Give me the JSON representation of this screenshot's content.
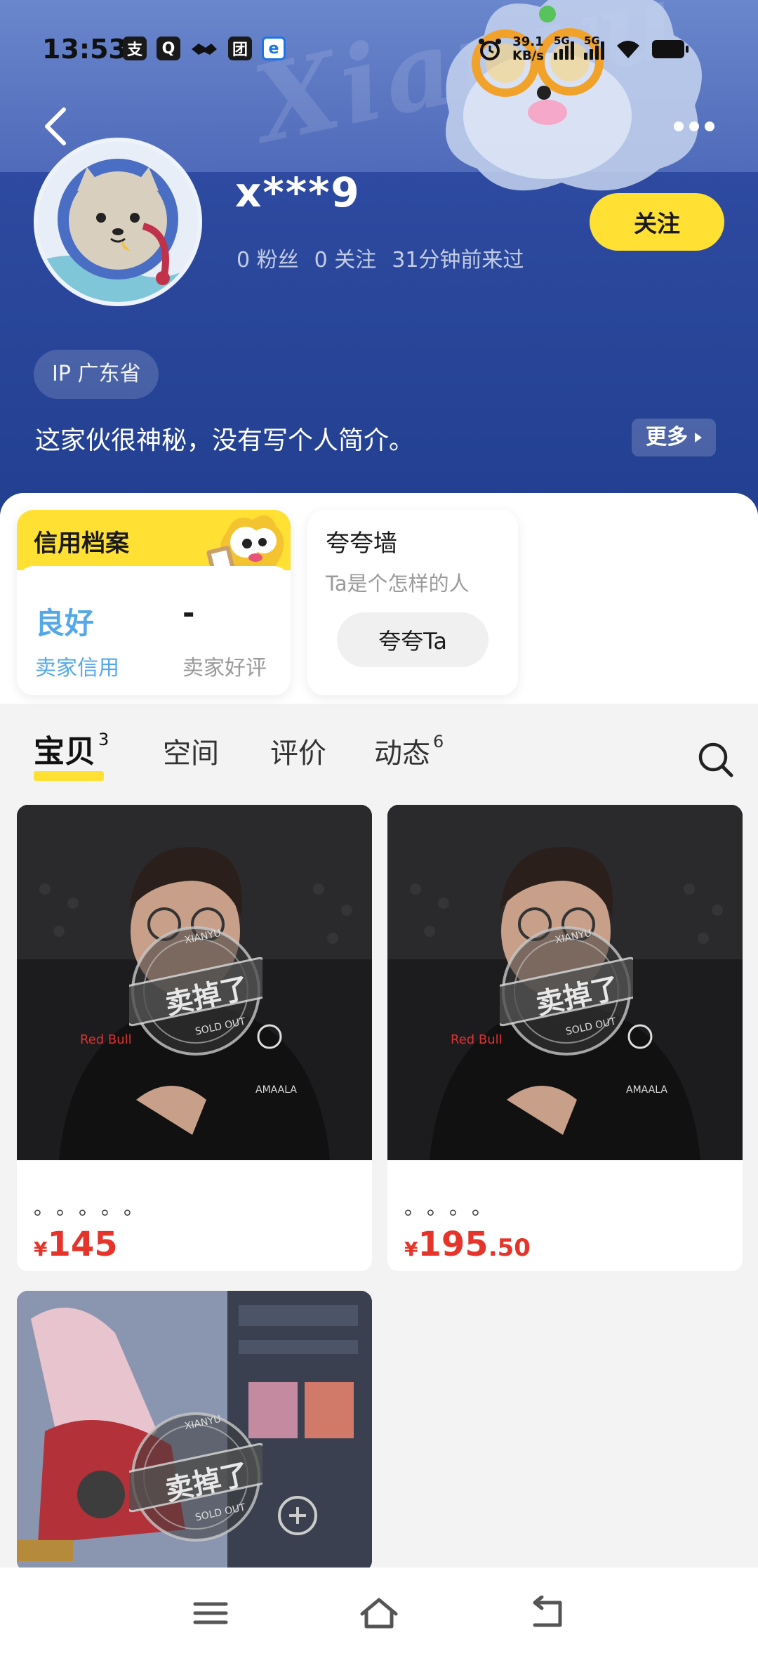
{
  "status_bar": {
    "time": "13:53",
    "app_icons": [
      "支",
      "Q",
      "团",
      "e"
    ],
    "net_speed_value": "39.1",
    "net_speed_unit": "KB/s",
    "sim1": "5G",
    "sim2": "5G"
  },
  "profile": {
    "username": "x***9",
    "fans": "0 粉丝",
    "following": "0 关注",
    "last_seen": "31分钟前来过",
    "follow_label": "关注",
    "ip": "IP 广东省",
    "bio": "这家伙很神秘，没有写个人简介。",
    "more_label": "更多",
    "watermark": "Xianyu"
  },
  "credit": {
    "title": "信用档案",
    "seller_credit_value": "良好",
    "seller_credit_label": "卖家信用",
    "seller_review_value": "-",
    "seller_review_label": "卖家好评"
  },
  "praise": {
    "title": "夸夸墙",
    "subtitle": "Ta是个怎样的人",
    "button": "夸夸Ta"
  },
  "tabs": [
    {
      "label": "宝贝",
      "count": "3"
    },
    {
      "label": "空间",
      "count": ""
    },
    {
      "label": "评价",
      "count": ""
    },
    {
      "label": "动态",
      "count": "6"
    }
  ],
  "items": [
    {
      "title": "。。。。。",
      "price_symbol": "¥",
      "price_int": "145",
      "price_dec": "",
      "stamp_text": "卖掉了",
      "stamp_sub": "SOLD OUT",
      "stamp_top": "XIANYU"
    },
    {
      "title": "。。。。",
      "price_symbol": "¥",
      "price_int": "195",
      "price_dec": ".50",
      "stamp_text": "卖掉了",
      "stamp_sub": "SOLD OUT",
      "stamp_top": "XIANYU"
    },
    {
      "title": "",
      "price_symbol": "",
      "price_int": "",
      "price_dec": "",
      "stamp_text": "卖掉了",
      "stamp_sub": "SOLD OUT",
      "stamp_top": "XIANYU"
    }
  ],
  "colors": {
    "accent_yellow": "#ffe033",
    "price_red": "#e5342a",
    "credit_blue": "#55a8e8",
    "header_blue": "#2d4aa0"
  }
}
